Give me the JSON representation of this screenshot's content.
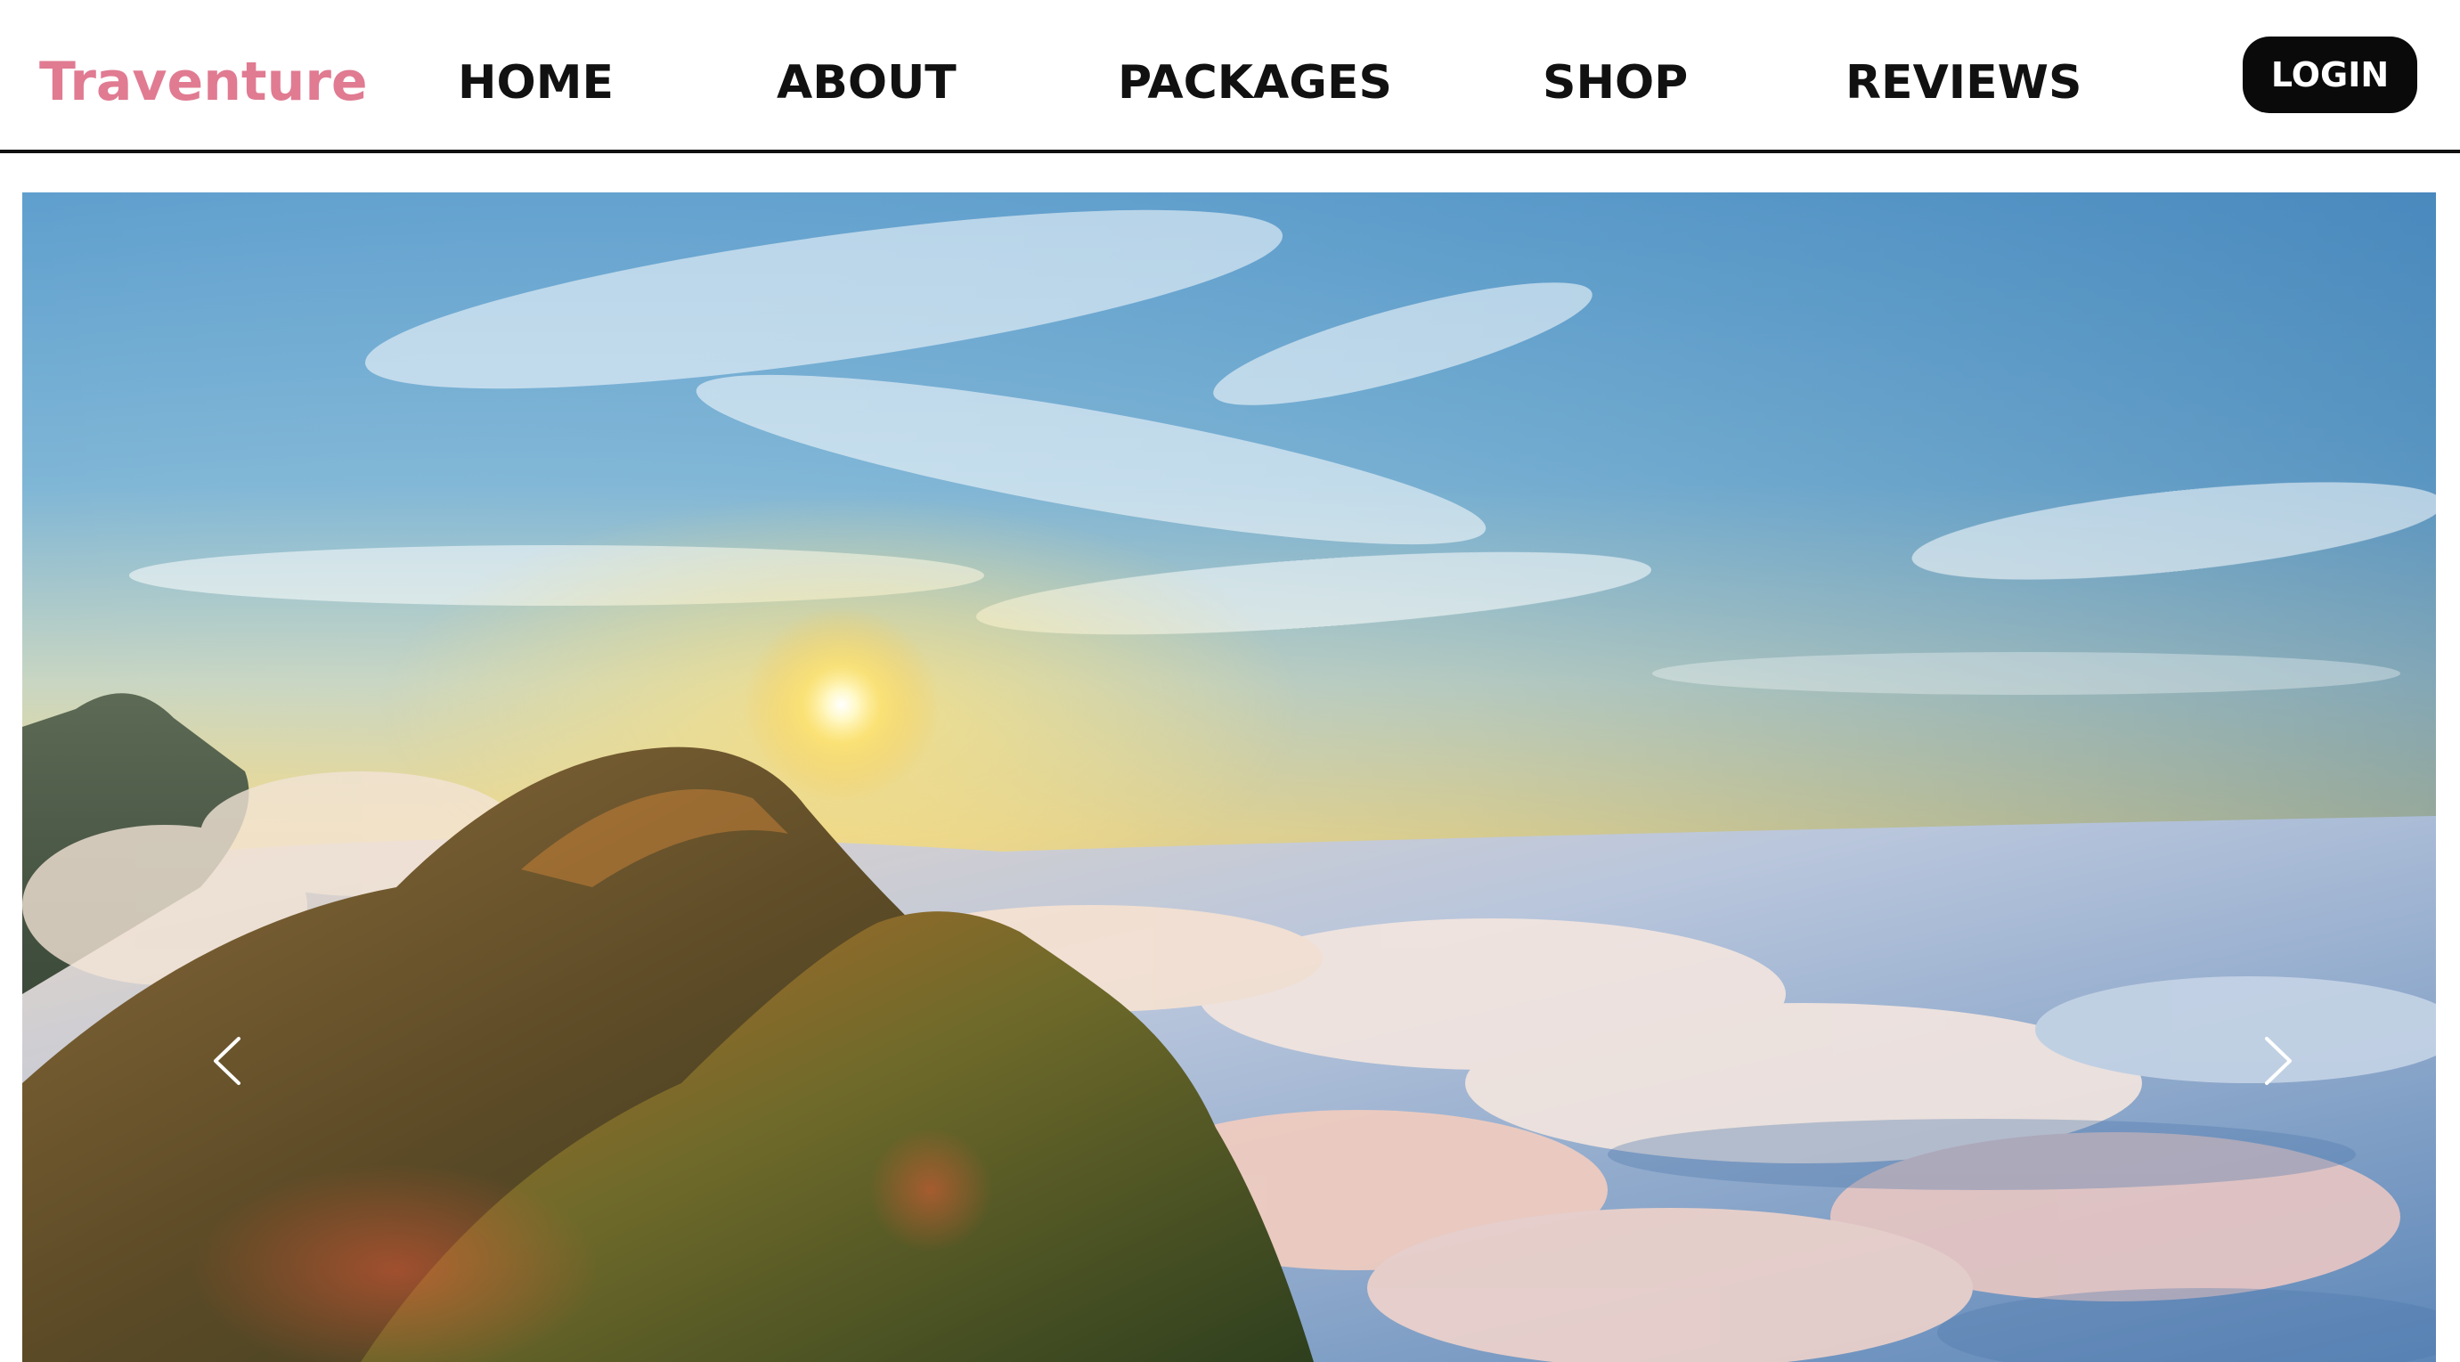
{
  "header": {
    "brand": "Traventure",
    "brand_color": "#e07b92",
    "nav": {
      "home": "HOME",
      "about": "ABOUT",
      "packages": "PACKAGES",
      "shop": "SHOP",
      "reviews": "REVIEWS"
    },
    "login_label": "LOGIN"
  },
  "hero": {
    "image": "sunrise-over-mountain-peak-above-clouds",
    "prev_icon": "chevron-left-icon",
    "next_icon": "chevron-right-icon"
  }
}
